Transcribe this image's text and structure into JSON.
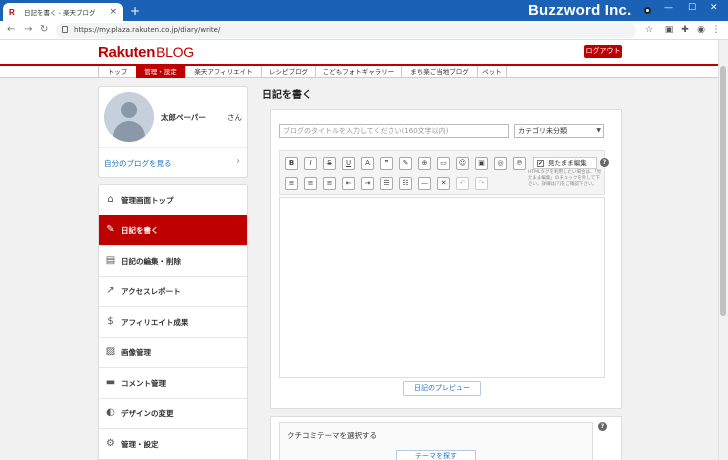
{
  "browser": {
    "tab_title": "日記を書く - 楽天ブログ",
    "tab_favicon": "R",
    "new_tab": "+",
    "brand_overlay": "Buzzword Inc.",
    "url": "https://my.plaza.rakuten.co.jp/diary/write/",
    "win_min": "—",
    "win_max": "☐",
    "win_close": "✕"
  },
  "site": {
    "logo_main": "Rakuten",
    "logo_sub": "BLOG",
    "logout_label": "ログアウト",
    "accent_color": "#bf0000"
  },
  "menu": [
    {
      "label": "トップ"
    },
    {
      "label": "管理・設定"
    },
    {
      "label": "楽天アフィリエイト"
    },
    {
      "label": "レシピブログ"
    },
    {
      "label": "こどもフォトギャラリー"
    },
    {
      "label": "まち楽ご当地ブログ"
    },
    {
      "label": "ペット"
    }
  ],
  "profile": {
    "name": "太郎ペーパー",
    "suffix": "さん",
    "my_blog_link": "自分のブログを見る"
  },
  "sidebar": [
    {
      "label": "管理画面トップ",
      "icon": "home-icon"
    },
    {
      "label": "日記を書く",
      "icon": "pencil-icon"
    },
    {
      "label": "日記の編集・削除",
      "icon": "document-icon"
    },
    {
      "label": "アクセスレポート",
      "icon": "trend-icon"
    },
    {
      "label": "アフィリエイト成果",
      "icon": "moneybag-icon"
    },
    {
      "label": "画像管理",
      "icon": "image-icon"
    },
    {
      "label": "コメント管理",
      "icon": "comment-icon"
    },
    {
      "label": "デザインの変更",
      "icon": "palette-icon"
    },
    {
      "label": "管理・設定",
      "icon": "gear-icon"
    }
  ],
  "editor": {
    "page_title": "日記を書く",
    "title_placeholder": "ブログのタイトルを入力してください(160文字以内)",
    "category_selected": "カテゴリ未分類",
    "raw_edit_label": "見たまま編集",
    "raw_edit_checked": "✔",
    "help_mark": "?",
    "html_note": "HTMLタグを利用したい場合は、「見たまま編集」のチェックを外して下さい。詳細は[?]をご確認下さい。",
    "preview_label": "日記のプレビュー",
    "toolbar_row1": [
      "B",
      "I",
      "S",
      "U",
      "A",
      "❞",
      "✎",
      "⊕",
      "▭",
      "☺",
      "▣",
      "◎",
      "℗"
    ],
    "toolbar_row2": [
      "≡",
      "≡",
      "≡",
      "⇤",
      "⇥",
      "☰",
      "☷",
      "—",
      "✕",
      "↶",
      "↷"
    ]
  },
  "theme": {
    "label": "クチコミテーマを選択する",
    "button": "テーマを探す"
  }
}
